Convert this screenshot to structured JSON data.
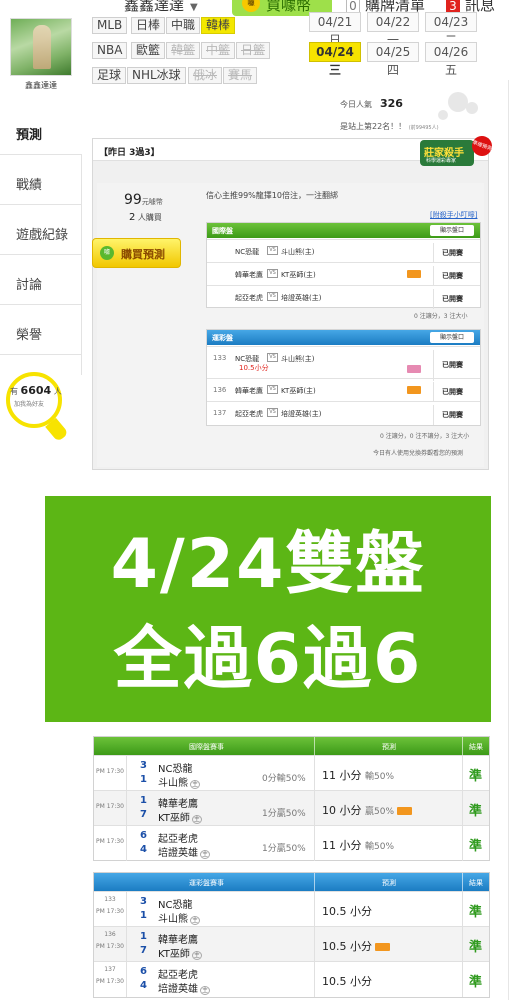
{
  "header": {
    "username": "鑫鑫達達",
    "buy_coin": "買噱幣",
    "buy_coin_icon": "coin-icon",
    "cart_count": "0",
    "cart_label": "購牌清單",
    "message_count": "3",
    "message_label": "訊息"
  },
  "profile": {
    "name": "鑫鑫達達"
  },
  "sports_rows": [
    [
      "MLB",
      "日棒",
      "中職",
      "韓棒"
    ],
    [
      "NBA",
      "歐籃",
      "韓籃",
      "中籃",
      "日籃"
    ],
    [
      "足球",
      "NHL冰球",
      "俄冰",
      "賽馬"
    ]
  ],
  "dates": [
    "04/21 日",
    "04/22 一",
    "04/23 二",
    "04/24 三",
    "04/25 四",
    "04/26 五"
  ],
  "active_date": "04/24 三",
  "stats": {
    "popularity_label": "今日人氣",
    "popularity_value": "326",
    "rank_text": "是站上第22名！！",
    "rank_suffix": "(前99495人)"
  },
  "nav": {
    "items": [
      "預測",
      "戰績",
      "遊戲紀錄",
      "討論",
      "榮譽"
    ],
    "followers_prefix": "有",
    "followers_count": "6604",
    "followers_suffix": "人",
    "followers_sub": "加我為好友"
  },
  "card": {
    "title": "【昨日 3過3】",
    "badge_title": "莊家殺手",
    "badge_sub": "科學運彩專家",
    "badge_seal": "準確預測",
    "price": "99",
    "price_unit": "元噱幣",
    "buyers_count": "2",
    "buyers_label": "人購買",
    "buy_button": "購買預測",
    "confidence": "信心主推99%龍擇10倍注，一注翻綁",
    "lottery_link": "[附殺手小叮嚀]",
    "intl_panel": {
      "title": "國際盤",
      "button": "顯示盤口",
      "rows": [
        {
          "team1": "NC恐龍",
          "team2": "斗山熊(主)",
          "result": "已開賽",
          "icon": false
        },
        {
          "team1": "韓華老鷹",
          "team2": "KT巫師(主)",
          "result": "已開賽",
          "icon": true
        },
        {
          "team1": "起亞老虎",
          "team2": "培證英雄(主)",
          "result": "已開賽",
          "icon": false
        }
      ],
      "note": "0 注讓分，3 注大小"
    },
    "lottery_panel": {
      "title": "運彩盤",
      "button": "顯示盤口",
      "rows": [
        {
          "code": "133",
          "team1": "NC恐龍",
          "team2": "斗山熊(主)",
          "sub": "10.5小分",
          "result": "已開賽",
          "icon": true
        },
        {
          "code": "136",
          "team1": "韓華老鷹",
          "team2": "KT巫師(主)",
          "sub": "",
          "result": "已開賽",
          "icon": true
        },
        {
          "code": "137",
          "team1": "起亞老虎",
          "team2": "培證英雄(主)",
          "sub": "",
          "result": "已開賽",
          "icon": false
        }
      ],
      "note": "0 注讓分，0 注不讓分，3 注大小",
      "footer": "今日有人使用兌換券觀看您的預測"
    }
  },
  "banner": {
    "line1": "4/24雙盤",
    "line2": "全過6過6",
    "color": "#5cb615"
  },
  "results_intl": {
    "headers": [
      "國際盤賽事",
      "預測",
      "結果"
    ],
    "rows": [
      {
        "time": "PM 17:30",
        "s1": "3",
        "t1": "NC恐龍",
        "s2": "1",
        "t2": "斗山熊",
        "home": "主",
        "line": "0分輸50%",
        "pred": "11 小分",
        "pred_note": "輸50%",
        "icon": false,
        "result": "準"
      },
      {
        "time": "PM 17:30",
        "s1": "1",
        "t1": "韓華老鷹",
        "s2": "7",
        "t2": "KT巫師",
        "home": "主",
        "line": "1分贏50%",
        "pred": "10 小分",
        "pred_note": "贏50%",
        "icon": true,
        "result": "準"
      },
      {
        "time": "PM 17:30",
        "s1": "6",
        "t1": "起亞老虎",
        "s2": "4",
        "t2": "培證英雄",
        "home": "主",
        "line": "1分贏50%",
        "pred": "11 小分",
        "pred_note": "輸50%",
        "icon": false,
        "result": "準"
      }
    ]
  },
  "results_lottery": {
    "headers": [
      "運彩盤賽事",
      "預測",
      "結果"
    ],
    "rows": [
      {
        "code": "133",
        "time": "PM 17:30",
        "s1": "3",
        "t1": "NC恐龍",
        "s2": "1",
        "t2": "斗山熊",
        "home": "主",
        "pred": "10.5 小分",
        "icon": false,
        "result": "準"
      },
      {
        "code": "136",
        "time": "PM 17:30",
        "s1": "1",
        "t1": "韓華老鷹",
        "s2": "7",
        "t2": "KT巫師",
        "home": "主",
        "pred": "10.5 小分",
        "icon": true,
        "result": "準"
      },
      {
        "code": "137",
        "time": "PM 17:30",
        "s1": "6",
        "t1": "起亞老虎",
        "s2": "4",
        "t2": "培證英雄",
        "home": "主",
        "pred": "10.5 小分",
        "icon": false,
        "result": "準"
      }
    ]
  }
}
